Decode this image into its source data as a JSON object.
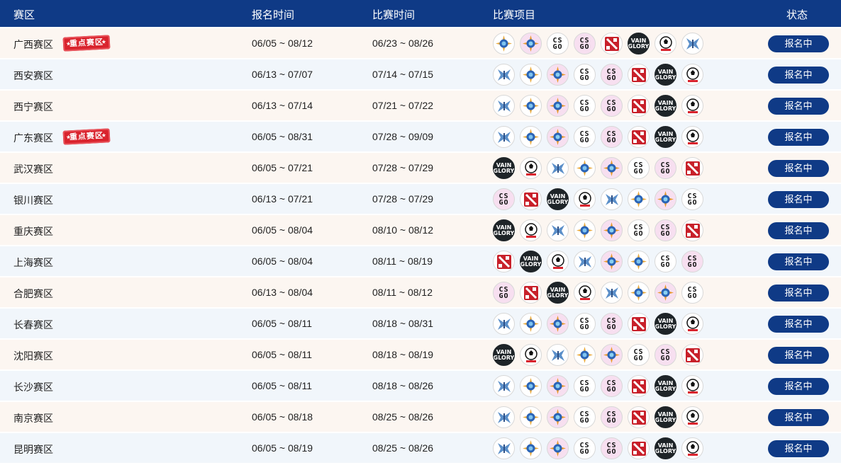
{
  "header": {
    "region": "赛区",
    "registration_time": "报名时间",
    "match_time": "比赛时间",
    "games": "比赛项目",
    "status": "状态"
  },
  "featured_badge_text": "重点赛区",
  "game_icon_names": {
    "hs": "hearthstone-icon",
    "ow": "overwatch-icon",
    "csgo": "csgo-icon",
    "csgo_pink": "csgo-icon",
    "dota": "dota2-icon",
    "vg": "vainglory-icon",
    "fifa": "fifa-online-icon",
    "sc": "starcraft-icon"
  },
  "colors": {
    "header_bg": "#0f3a86",
    "button_bg": "#0f3a86",
    "row_odd_bg": "#fcf6f1",
    "row_even_bg": "#f1f6fb",
    "badge_red": "#d9232d"
  },
  "rows": [
    {
      "region": "广西赛区",
      "featured": true,
      "registration": "06/05 ~ 08/12",
      "match": "06/23 ~ 08/26",
      "games": [
        "hs",
        "ow",
        "csgo",
        "csgo_pink",
        "dota",
        "vg",
        "fifa",
        "sc"
      ],
      "status": "报名中"
    },
    {
      "region": "西安赛区",
      "featured": false,
      "registration": "06/13 ~ 07/07",
      "match": "07/14 ~ 07/15",
      "games": [
        "sc",
        "hs",
        "ow",
        "csgo",
        "csgo_pink",
        "dota",
        "vg",
        "fifa"
      ],
      "status": "报名中"
    },
    {
      "region": "西宁赛区",
      "featured": false,
      "registration": "06/13 ~ 07/14",
      "match": "07/21 ~ 07/22",
      "games": [
        "sc",
        "hs",
        "ow",
        "csgo",
        "csgo_pink",
        "dota",
        "vg",
        "fifa"
      ],
      "status": "报名中"
    },
    {
      "region": "广东赛区",
      "featured": true,
      "registration": "06/05 ~ 08/31",
      "match": "07/28 ~ 09/09",
      "games": [
        "sc",
        "hs",
        "ow",
        "csgo",
        "csgo_pink",
        "dota",
        "vg",
        "fifa"
      ],
      "status": "报名中"
    },
    {
      "region": "武汉赛区",
      "featured": false,
      "registration": "06/05 ~ 07/21",
      "match": "07/28 ~ 07/29",
      "games": [
        "vg",
        "fifa",
        "sc",
        "hs",
        "ow",
        "csgo",
        "csgo_pink",
        "dota"
      ],
      "status": "报名中"
    },
    {
      "region": "银川赛区",
      "featured": false,
      "registration": "06/13 ~ 07/21",
      "match": "07/28 ~ 07/29",
      "games": [
        "csgo_pink",
        "dota",
        "vg",
        "fifa",
        "sc",
        "hs",
        "ow",
        "csgo"
      ],
      "status": "报名中"
    },
    {
      "region": "重庆赛区",
      "featured": false,
      "registration": "06/05 ~ 08/04",
      "match": "08/10 ~ 08/12",
      "games": [
        "vg",
        "fifa",
        "sc",
        "hs",
        "ow",
        "csgo",
        "csgo_pink",
        "dota"
      ],
      "status": "报名中"
    },
    {
      "region": "上海赛区",
      "featured": false,
      "registration": "06/05 ~ 08/04",
      "match": "08/11 ~ 08/19",
      "games": [
        "dota",
        "vg",
        "fifa",
        "sc",
        "ow",
        "hs",
        "csgo",
        "csgo_pink"
      ],
      "status": "报名中"
    },
    {
      "region": "合肥赛区",
      "featured": false,
      "registration": "06/13 ~ 08/04",
      "match": "08/11 ~ 08/12",
      "games": [
        "csgo_pink",
        "dota",
        "vg",
        "fifa",
        "sc",
        "hs",
        "ow",
        "csgo"
      ],
      "status": "报名中"
    },
    {
      "region": "长春赛区",
      "featured": false,
      "registration": "06/05 ~ 08/11",
      "match": "08/18 ~ 08/31",
      "games": [
        "sc",
        "hs",
        "ow",
        "csgo",
        "csgo_pink",
        "dota",
        "vg",
        "fifa"
      ],
      "status": "报名中"
    },
    {
      "region": "沈阳赛区",
      "featured": false,
      "registration": "06/05 ~ 08/11",
      "match": "08/18 ~ 08/19",
      "games": [
        "vg",
        "fifa",
        "sc",
        "hs",
        "ow",
        "csgo",
        "csgo_pink",
        "dota"
      ],
      "status": "报名中"
    },
    {
      "region": "长沙赛区",
      "featured": false,
      "registration": "06/05 ~ 08/11",
      "match": "08/18 ~ 08/26",
      "games": [
        "sc",
        "hs",
        "ow",
        "csgo",
        "csgo_pink",
        "dota",
        "vg",
        "fifa"
      ],
      "status": "报名中"
    },
    {
      "region": "南京赛区",
      "featured": false,
      "registration": "06/05 ~ 08/18",
      "match": "08/25 ~ 08/26",
      "games": [
        "sc",
        "hs",
        "ow",
        "csgo",
        "csgo_pink",
        "dota",
        "vg",
        "fifa"
      ],
      "status": "报名中"
    },
    {
      "region": "昆明赛区",
      "featured": false,
      "registration": "06/05 ~ 08/19",
      "match": "08/25 ~ 08/26",
      "games": [
        "sc",
        "hs",
        "ow",
        "csgo",
        "csgo_pink",
        "dota",
        "vg",
        "fifa"
      ],
      "status": "报名中"
    }
  ]
}
